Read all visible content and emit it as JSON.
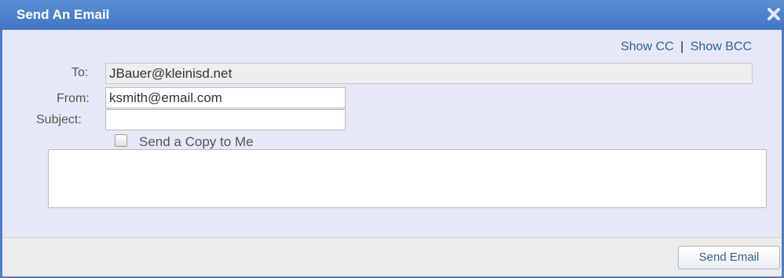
{
  "dialog": {
    "title": "Send An Email",
    "close_icon": "close-icon"
  },
  "links": {
    "show_cc": "Show CC",
    "separator": "|",
    "show_bcc": "Show BCC"
  },
  "form": {
    "to_label": "To:",
    "to_value": "JBauer@kleinisd.net",
    "from_label": "From:",
    "from_value": "ksmith@email.com",
    "subject_label": "Subject:",
    "subject_value": "",
    "copy_label": "Send a Copy to Me",
    "copy_checked": false,
    "message_value": ""
  },
  "footer": {
    "send_label": "Send Email"
  },
  "colors": {
    "titlebar": "#4a82cc",
    "dialog_background": "#e7e8f7",
    "link": "#2f5f98"
  }
}
